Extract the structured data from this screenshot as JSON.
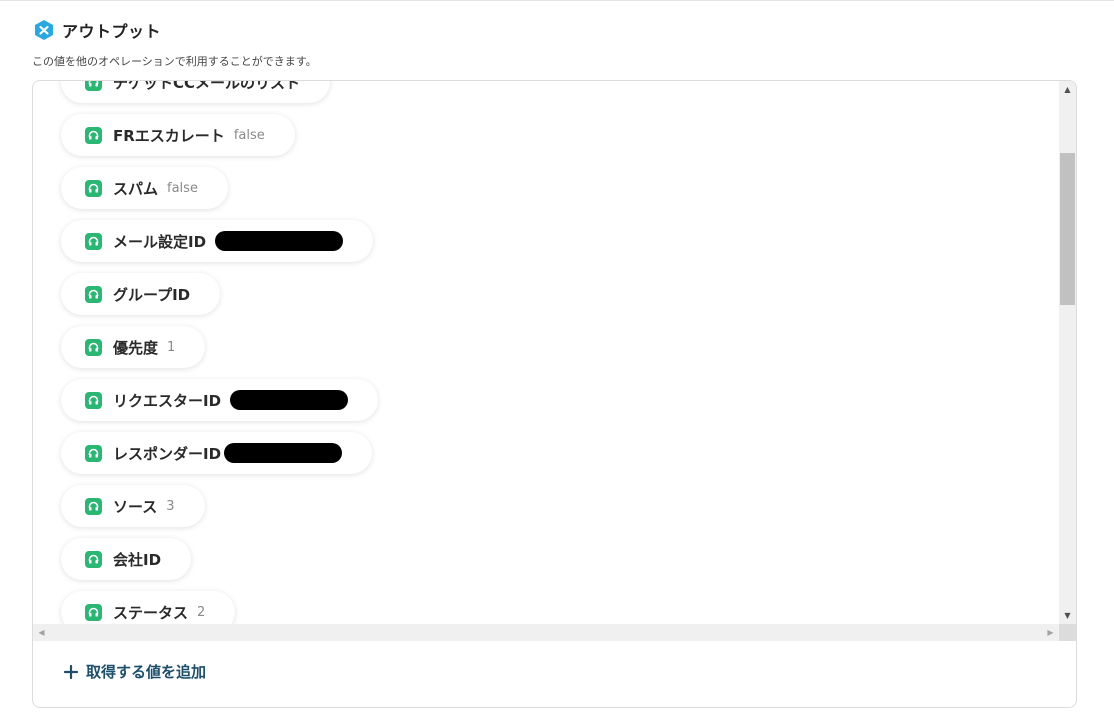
{
  "header": {
    "title": "アウトプット",
    "description": "この値を他のオペレーションで利用することができます。",
    "logo_color": "#29a8df"
  },
  "outputs": [
    {
      "label": "チケットCCメールのリスト",
      "value": ""
    },
    {
      "label": "FRエスカレート",
      "value": "false"
    },
    {
      "label": "スパム",
      "value": "false"
    },
    {
      "label": "メール設定ID",
      "value": "",
      "redacted": true
    },
    {
      "label": "グループID",
      "value": ""
    },
    {
      "label": "優先度",
      "value": "1"
    },
    {
      "label": "リクエスターID",
      "value": "",
      "redacted": true
    },
    {
      "label": "レスポンダーID",
      "value": "",
      "redacted": true
    },
    {
      "label": "ソース",
      "value": "3"
    },
    {
      "label": "会社ID",
      "value": ""
    },
    {
      "label": "ステータス",
      "value": "2"
    }
  ],
  "output_icon": "headset-icon",
  "output_icon_color": "#2bb673",
  "add_button": {
    "label": "取得する値を追加",
    "icon": "plus-icon",
    "color": "#1d4f6b"
  },
  "scrollbar": {
    "vertical_position": 0.27
  }
}
